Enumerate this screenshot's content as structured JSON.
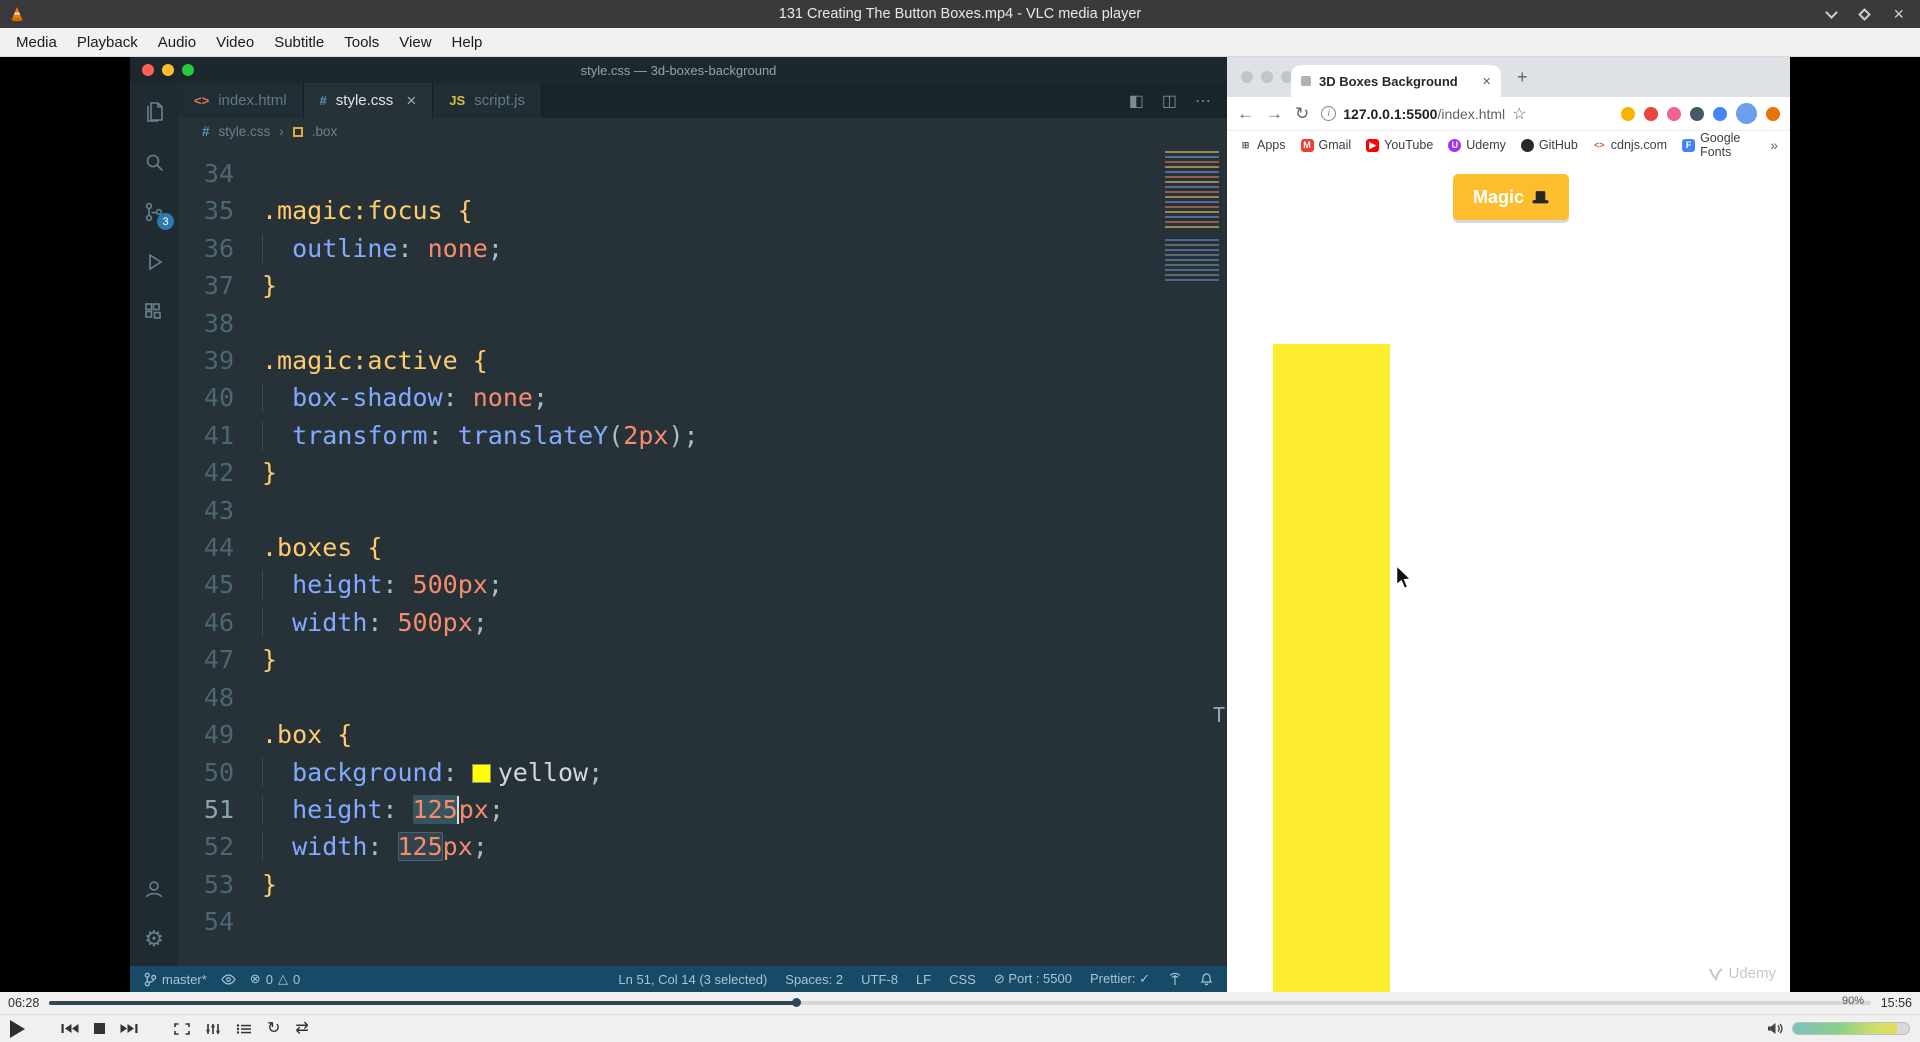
{
  "vlc": {
    "title": "131 Creating The Button Boxes.mp4 - VLC media player",
    "menu": [
      "Media",
      "Playback",
      "Audio",
      "Video",
      "Subtitle",
      "Tools",
      "View",
      "Help"
    ],
    "time_elapsed": "06:28",
    "time_total": "15:56",
    "progress_pct": 41,
    "volume_pct": 90,
    "volume_label": "90%",
    "glyphs": {
      "close": "×",
      "loop": "↻",
      "shuffle": "⇄"
    }
  },
  "vscode": {
    "window_title": "style.css — 3d-boxes-background",
    "scm_badge": "3",
    "tab_close_glyph": "×",
    "tabs": [
      {
        "label": "index.html",
        "glyph": "<>",
        "glyph_color": "#e07b53",
        "active": false
      },
      {
        "label": "style.css",
        "glyph": "#",
        "glyph_color": "#519aba",
        "active": true
      },
      {
        "label": "script.js",
        "glyph": "JS",
        "glyph_color": "#dcbe3c",
        "active": false
      }
    ],
    "tab_actions": [
      "◧",
      "◫",
      "⋯"
    ],
    "breadcrumb": {
      "file_glyph": "#",
      "file": "style.css",
      "sep": "›",
      "symbol": ".box"
    },
    "swatch_color": "#ffff00",
    "stray_text": "T",
    "code": [
      {
        "n": "34",
        "s": []
      },
      {
        "n": "35",
        "s": [
          {
            "t": ".magic:focus ",
            "c": "sel"
          },
          {
            "t": "{",
            "c": "brace"
          }
        ]
      },
      {
        "n": "36",
        "s": [
          {
            "t": "  ",
            "c": "ind"
          },
          {
            "t": "outline",
            "c": "prop"
          },
          {
            "t": ":",
            "c": "pn"
          },
          {
            "t": " ",
            "c": ""
          },
          {
            "t": "none",
            "c": "val"
          },
          {
            "t": ";",
            "c": "pn"
          }
        ]
      },
      {
        "n": "37",
        "s": [
          {
            "t": "}",
            "c": "brace"
          }
        ]
      },
      {
        "n": "38",
        "s": []
      },
      {
        "n": "39",
        "s": [
          {
            "t": ".magic:active ",
            "c": "sel"
          },
          {
            "t": "{",
            "c": "brace"
          }
        ]
      },
      {
        "n": "40",
        "s": [
          {
            "t": "  ",
            "c": "ind"
          },
          {
            "t": "box-shadow",
            "c": "prop"
          },
          {
            "t": ":",
            "c": "pn"
          },
          {
            "t": " ",
            "c": ""
          },
          {
            "t": "none",
            "c": "val"
          },
          {
            "t": ";",
            "c": "pn"
          }
        ]
      },
      {
        "n": "41",
        "s": [
          {
            "t": "  ",
            "c": "ind"
          },
          {
            "t": "transform",
            "c": "prop"
          },
          {
            "t": ":",
            "c": "pn"
          },
          {
            "t": " ",
            "c": ""
          },
          {
            "t": "translateY",
            "c": "fn"
          },
          {
            "t": "(",
            "c": "pn"
          },
          {
            "t": "2px",
            "c": "val"
          },
          {
            "t": ")",
            "c": "pn"
          },
          {
            "t": ";",
            "c": "pn"
          }
        ]
      },
      {
        "n": "42",
        "s": [
          {
            "t": "}",
            "c": "brace"
          }
        ]
      },
      {
        "n": "43",
        "s": []
      },
      {
        "n": "44",
        "s": [
          {
            "t": ".boxes ",
            "c": "sel"
          },
          {
            "t": "{",
            "c": "brace"
          }
        ]
      },
      {
        "n": "45",
        "s": [
          {
            "t": "  ",
            "c": "ind"
          },
          {
            "t": "height",
            "c": "prop"
          },
          {
            "t": ":",
            "c": "pn"
          },
          {
            "t": " ",
            "c": ""
          },
          {
            "t": "500px",
            "c": "val"
          },
          {
            "t": ";",
            "c": "pn"
          }
        ]
      },
      {
        "n": "46",
        "s": [
          {
            "t": "  ",
            "c": "ind"
          },
          {
            "t": "width",
            "c": "prop"
          },
          {
            "t": ":",
            "c": "pn"
          },
          {
            "t": " ",
            "c": ""
          },
          {
            "t": "500px",
            "c": "val"
          },
          {
            "t": ";",
            "c": "pn"
          }
        ]
      },
      {
        "n": "47",
        "s": [
          {
            "t": "}",
            "c": "brace"
          }
        ]
      },
      {
        "n": "48",
        "s": []
      },
      {
        "n": "49",
        "s": [
          {
            "t": ".box ",
            "c": "sel"
          },
          {
            "t": "{",
            "c": "brace"
          }
        ]
      },
      {
        "n": "50",
        "s": [
          {
            "t": "  ",
            "c": "ind"
          },
          {
            "t": "background",
            "c": "prop"
          },
          {
            "t": ":",
            "c": "pn"
          },
          {
            "t": " ",
            "c": ""
          },
          {
            "t": "",
            "c": "swatch"
          },
          {
            "t": "yellow",
            "c": "plain"
          },
          {
            "t": ";",
            "c": "pn"
          }
        ]
      },
      {
        "n": "51",
        "cur": true,
        "s": [
          {
            "t": "  ",
            "c": "ind"
          },
          {
            "t": "height",
            "c": "prop"
          },
          {
            "t": ":",
            "c": "pn"
          },
          {
            "t": " ",
            "c": ""
          },
          {
            "t": "125",
            "c": "val selhl"
          },
          {
            "t": "",
            "c": "cursor"
          },
          {
            "t": "px",
            "c": "val"
          },
          {
            "t": ";",
            "c": "pn"
          }
        ]
      },
      {
        "n": "52",
        "s": [
          {
            "t": "  ",
            "c": "ind"
          },
          {
            "t": "width",
            "c": "prop"
          },
          {
            "t": ":",
            "c": "pn"
          },
          {
            "t": " ",
            "c": ""
          },
          {
            "t": "125",
            "c": "val occhl"
          },
          {
            "t": "px",
            "c": "val"
          },
          {
            "t": ";",
            "c": "pn"
          }
        ]
      },
      {
        "n": "53",
        "s": [
          {
            "t": "}",
            "c": "brace"
          }
        ]
      },
      {
        "n": "54",
        "s": []
      }
    ],
    "status": {
      "branch": "master*",
      "error_glyph": "⊗",
      "errors": "0",
      "warn_glyph": "△",
      "warnings": "0",
      "right": [
        "Ln 51, Col 14 (3 selected)",
        "Spaces: 2",
        "UTF-8",
        "LF",
        "CSS",
        "⊘ Port : 5500",
        "Prettier: ✓"
      ]
    }
  },
  "browser": {
    "tab_title": "3D Boxes Background",
    "url_host": "127.0.0.1:5500",
    "url_path": "/index.html",
    "glyphs": {
      "back": "←",
      "forward": "→",
      "reload": "↻",
      "star": "☆",
      "plus": "+",
      "close_tab": "×",
      "info": "i",
      "overflow": "»"
    },
    "bookmarks": [
      {
        "label": "Apps",
        "glyph": "⊞",
        "fg": "#5f6368",
        "bg": ""
      },
      {
        "label": "Gmail",
        "glyph": "M",
        "fg": "#ffffff",
        "bg": "#ea4335"
      },
      {
        "label": "YouTube",
        "glyph": "▶",
        "fg": "#ffffff",
        "bg": "#ff0000"
      },
      {
        "label": "Udemy",
        "glyph": "U",
        "fg": "#ffffff",
        "bg": "#a435f0"
      },
      {
        "label": "GitHub",
        "glyph": "",
        "fg": "#ffffff",
        "bg": "#24292e"
      },
      {
        "label": "cdnjs.com",
        "glyph": "<>",
        "fg": "#cf5f2e",
        "bg": ""
      },
      {
        "label": "Google Fonts",
        "glyph": "F",
        "fg": "#ffffff",
        "bg": "#4285f4"
      }
    ],
    "extensions": [
      {
        "name": "extension-icon-yellow",
        "color": "#f7b500"
      },
      {
        "name": "extension-icon-red",
        "color": "#e8453c"
      },
      {
        "name": "extension-icon-pink",
        "color": "#f06292"
      },
      {
        "name": "extension-icon-dark",
        "color": "#455a64"
      },
      {
        "name": "extension-icon-blue",
        "color": "#4285f4"
      },
      {
        "name": "profile-avatar",
        "color": "#6d9eeb"
      },
      {
        "name": "update-indicator",
        "color": "#e8710a"
      }
    ],
    "page": {
      "button_label": "Magic",
      "button_color": "#fcbe2e",
      "box_color": "#fdee2f",
      "watermark": "Udemy"
    }
  }
}
